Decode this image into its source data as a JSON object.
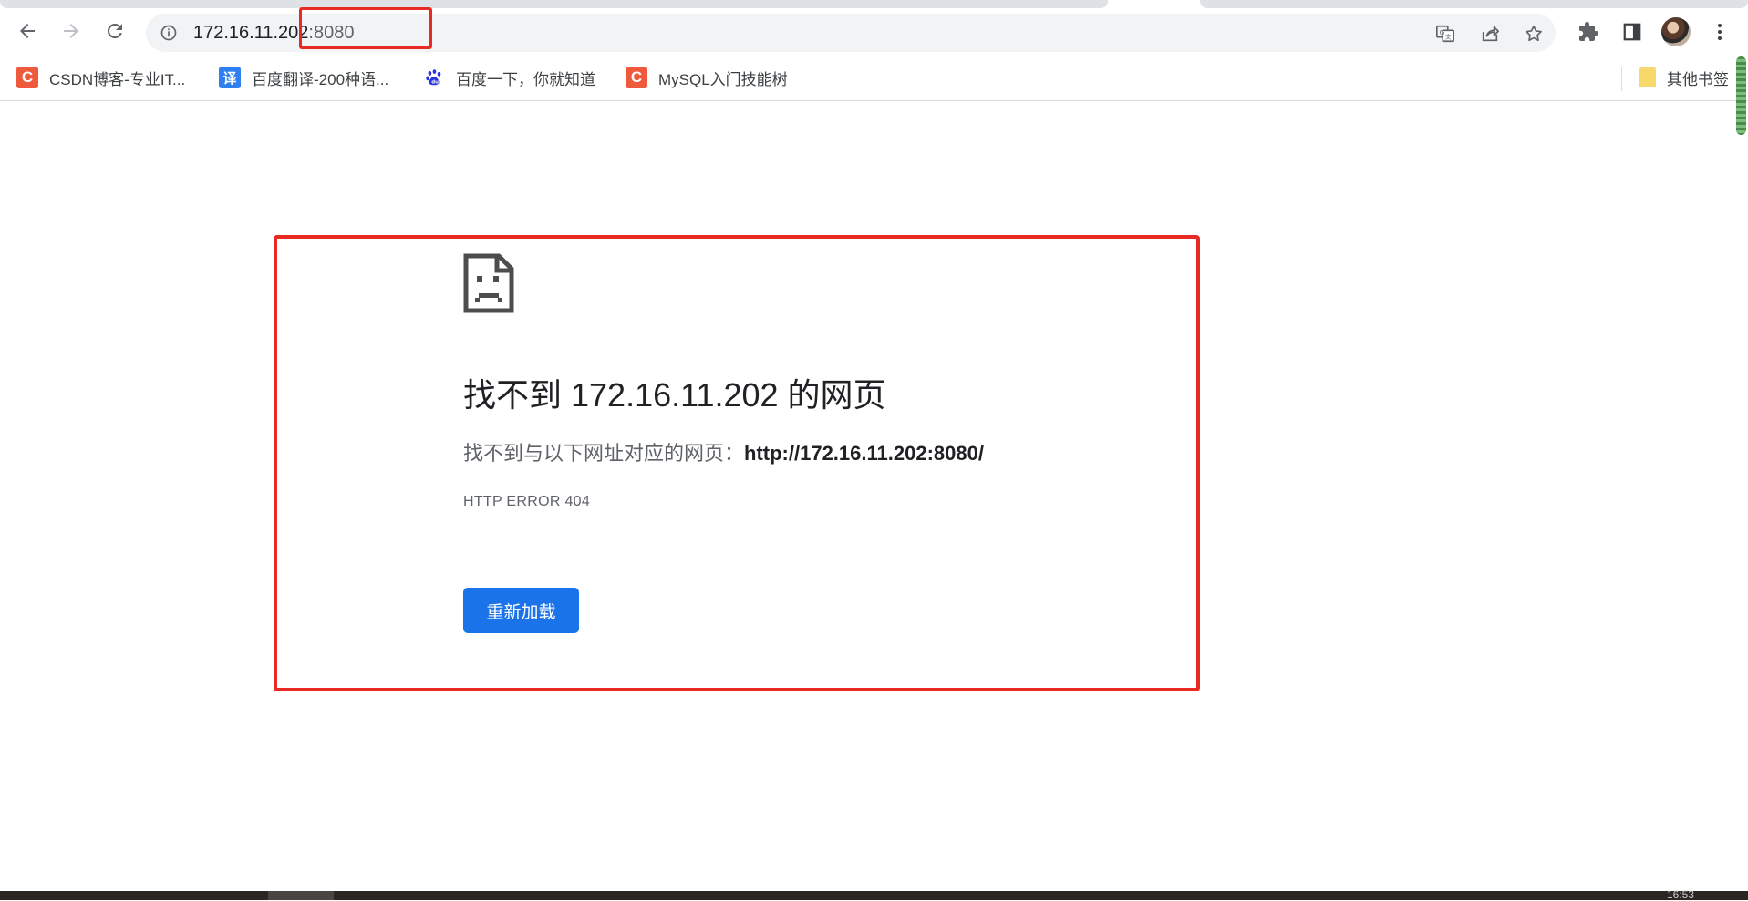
{
  "browser": {
    "url_host": "172.16.11.202",
    "url_port": ":8080"
  },
  "bookmarks": [
    {
      "label": "CSDN博客-专业IT...",
      "icon": "csdn-icon",
      "glyph": "C"
    },
    {
      "label": "百度翻译-200种语...",
      "icon": "fanyi-icon",
      "glyph": "译"
    },
    {
      "label": "百度一下，你就知道",
      "icon": "baidu-paw-icon"
    },
    {
      "label": "MySQL入门技能树",
      "icon": "csdn-icon",
      "glyph": "C"
    }
  ],
  "other_bookmarks": "其他书签",
  "error_page": {
    "title": "找不到 172.16.11.202 的网页",
    "subtitle_prefix": "找不到与以下网址对应的网页：",
    "subtitle_url": "http://172.16.11.202:8080/",
    "error_code": "HTTP ERROR 404",
    "reload_button": "重新加载",
    "icon": "sad-page-icon"
  },
  "taskbar": {
    "clock_partial": "16:53"
  },
  "colors": {
    "accent": "#1a73e8",
    "annotation": "#e82a22"
  }
}
